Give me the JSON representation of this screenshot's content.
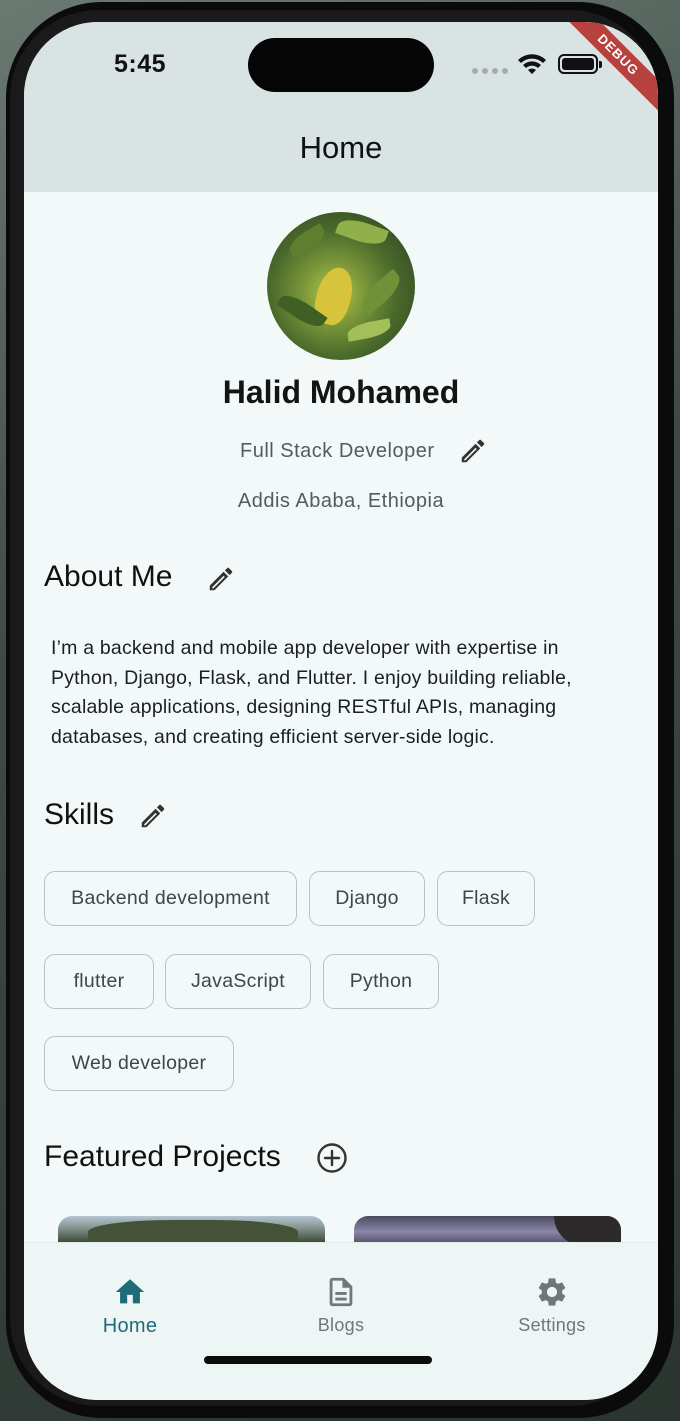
{
  "status_bar": {
    "time": "5:45",
    "debug_banner": "DEBUG",
    "icons": [
      "signal-dots-icon",
      "wifi-icon",
      "battery-icon"
    ]
  },
  "app_bar": {
    "title": "Home"
  },
  "profile": {
    "name": "Halid Mohamed",
    "role": "Full Stack Developer",
    "location": "Addis Ababa, Ethiopia"
  },
  "about": {
    "title": "About Me",
    "text": "I’m a backend and mobile app developer with expertise in Python, Django, Flask, and Flutter. I enjoy building reliable, scalable applications, designing RESTful APIs, managing databases, and creating efficient server-side logic."
  },
  "skills": {
    "title": "Skills",
    "items": [
      "Backend development",
      "Django",
      "Flask",
      "flutter",
      "JavaScript",
      "Python",
      "Web developer"
    ]
  },
  "projects": {
    "title": "Featured Projects"
  },
  "bottom_nav": {
    "items": [
      {
        "label": "Home",
        "icon": "home-icon",
        "active": true
      },
      {
        "label": "Blogs",
        "icon": "document-icon",
        "active": false
      },
      {
        "label": "Settings",
        "icon": "gear-icon",
        "active": false
      }
    ]
  },
  "colors": {
    "accent": "#1f6b78",
    "app_bar_bg": "#d9e3e3",
    "page_bg": "#f3f9f9",
    "debug_banner": "#b8413d"
  }
}
